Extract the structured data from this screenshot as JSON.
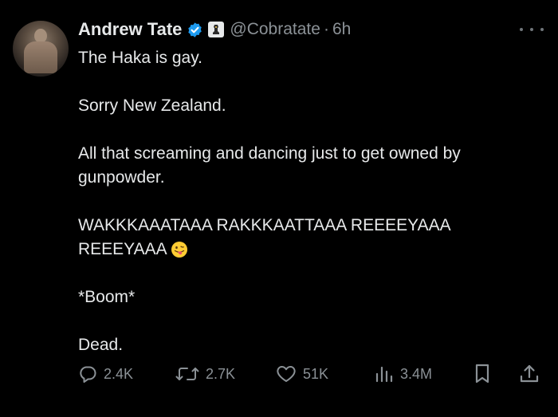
{
  "author": {
    "name": "Andrew Tate",
    "handle": "@Cobratate",
    "separator": "·",
    "time": "6h"
  },
  "tweet": {
    "paragraphs": [
      [
        "The Haka is gay."
      ],
      [
        "Sorry New Zealand."
      ],
      [
        "All that screaming and dancing just to get owned by",
        "gunpowder."
      ],
      [
        "WAKKKAAATAAA RAKKKAATTAAA REEEEYAAA",
        "REEEYAAA"
      ],
      [
        "*Boom*"
      ],
      [
        "Dead."
      ]
    ]
  },
  "actions": {
    "replies": "2.4K",
    "retweets": "2.7K",
    "likes": "51K",
    "views": "3.4M"
  },
  "icons": {
    "verified": "verified-badge-icon",
    "affiliate": "affiliate-badge-icon",
    "emoji": "face-with-tongue-emoji",
    "reply": "reply-icon",
    "retweet": "retweet-icon",
    "like": "heart-icon",
    "views": "views-bar-chart-icon",
    "bookmark": "bookmark-icon",
    "share": "share-icon",
    "more": "more-options-icon"
  },
  "colors": {
    "background": "#000000",
    "text": "#e7e9ea",
    "muted": "#8b9196",
    "verified_blue": "#1d9bf0"
  }
}
